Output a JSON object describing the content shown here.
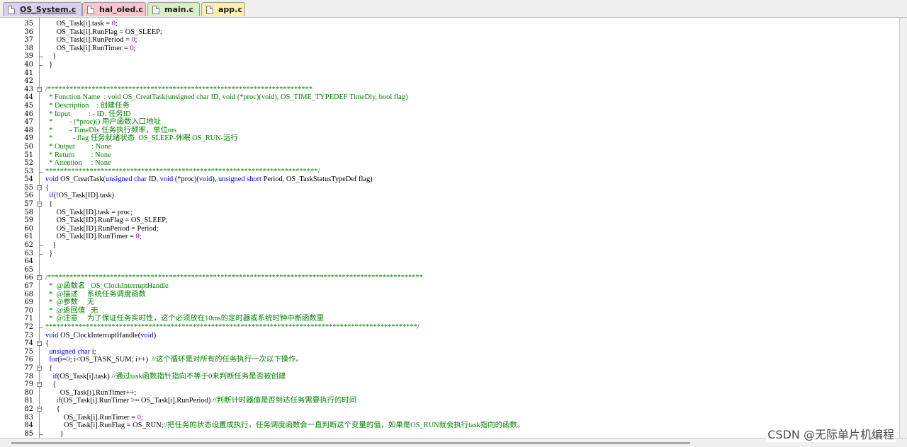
{
  "tabs": [
    {
      "label": "OS_System.c",
      "active": true,
      "color": "#d8d0ee"
    },
    {
      "label": "hal_oled.c",
      "active": false,
      "color": "#f7c6cc"
    },
    {
      "label": "main.c",
      "active": false,
      "color": "#d8efc6"
    },
    {
      "label": "app.c",
      "active": false,
      "color": "#fbefb0"
    }
  ],
  "lines": [
    {
      "n": "35",
      "fold": "",
      "segs": [
        [
          "t",
          "      OS_Task[i].task = "
        ],
        [
          "n",
          "0"
        ],
        [
          "t",
          ";"
        ]
      ]
    },
    {
      "n": "36",
      "fold": "",
      "segs": [
        [
          "t",
          "      OS_Task[i].RunFlag = OS_SLEEP;"
        ]
      ]
    },
    {
      "n": "37",
      "fold": "",
      "segs": [
        [
          "t",
          "      OS_Task[i].RunPeriod = "
        ],
        [
          "n",
          "0"
        ],
        [
          "t",
          ";"
        ]
      ]
    },
    {
      "n": "38",
      "fold": "",
      "segs": [
        [
          "t",
          "      OS_Task[i].RunTimer = "
        ],
        [
          "n",
          "0"
        ],
        [
          "t",
          ";"
        ]
      ]
    },
    {
      "n": "39",
      "fold": "end",
      "segs": [
        [
          "t",
          "    }"
        ]
      ]
    },
    {
      "n": "40",
      "fold": "end",
      "segs": [
        [
          "t",
          "  }"
        ]
      ]
    },
    {
      "n": "41",
      "fold": "",
      "segs": []
    },
    {
      "n": "42",
      "fold": "",
      "segs": []
    },
    {
      "n": "43",
      "fold": "open",
      "segs": [
        [
          "c",
          "/************************************************************************"
        ]
      ]
    },
    {
      "n": "44",
      "fold": "",
      "segs": [
        [
          "c",
          "  * Function Name  : void OS_CreatTask(unsigned char ID, void (*proc)(void), OS_TIME_TYPEDEF TimeDly, bool flag)"
        ]
      ]
    },
    {
      "n": "45",
      "fold": "",
      "segs": [
        [
          "c",
          "  * Description    : 创建任务"
        ]
      ]
    },
    {
      "n": "46",
      "fold": "",
      "segs": [
        [
          "c",
          "  * Input          : - ID: 任务ID"
        ]
      ]
    },
    {
      "n": "47",
      "fold": "",
      "segs": [
        [
          "c",
          "  *         - (*proc)() 用户函数入口地址"
        ]
      ]
    },
    {
      "n": "48",
      "fold": "",
      "segs": [
        [
          "c",
          "  *         - TimeDly 任务执行频率，单位ms"
        ]
      ]
    },
    {
      "n": "49",
      "fold": "",
      "segs": [
        [
          "c",
          "  *           - flag 任务就绪状态  OS_SLEEP-休眠 OS_RUN-运行"
        ]
      ]
    },
    {
      "n": "50",
      "fold": "",
      "segs": [
        [
          "c",
          "  * Output         : None"
        ]
      ]
    },
    {
      "n": "51",
      "fold": "",
      "segs": [
        [
          "c",
          "  * Return         : None"
        ]
      ]
    },
    {
      "n": "52",
      "fold": "",
      "segs": [
        [
          "c",
          "  * Attention     : None"
        ]
      ]
    },
    {
      "n": "53",
      "fold": "end",
      "segs": [
        [
          "c",
          "**************************************************************************/"
        ]
      ]
    },
    {
      "n": "54",
      "fold": "",
      "segs": [
        [
          "k",
          "void"
        ],
        [
          "t",
          " OS_CreatTask("
        ],
        [
          "k",
          "unsigned char"
        ],
        [
          "t",
          " ID, "
        ],
        [
          "k",
          "void"
        ],
        [
          "t",
          " (*proc)("
        ],
        [
          "k",
          "void"
        ],
        [
          "t",
          "), "
        ],
        [
          "k",
          "unsigned short"
        ],
        [
          "t",
          " Period, OS_TaskStatusTypeDef flag)"
        ]
      ]
    },
    {
      "n": "55",
      "fold": "open",
      "segs": [
        [
          "t",
          "{"
        ]
      ]
    },
    {
      "n": "56",
      "fold": "",
      "segs": [
        [
          "t",
          "  "
        ],
        [
          "k",
          "if"
        ],
        [
          "t",
          "(!OS_Task[ID].task)"
        ]
      ]
    },
    {
      "n": "57",
      "fold": "open",
      "segs": [
        [
          "t",
          "  {"
        ]
      ]
    },
    {
      "n": "58",
      "fold": "",
      "segs": [
        [
          "t",
          "      OS_Task[ID].task = proc;"
        ]
      ]
    },
    {
      "n": "59",
      "fold": "",
      "segs": [
        [
          "t",
          "      OS_Task[ID].RunFlag = OS_SLEEP;"
        ]
      ]
    },
    {
      "n": "60",
      "fold": "",
      "segs": [
        [
          "t",
          "      OS_Task[ID].RunPeriod = Period;"
        ]
      ]
    },
    {
      "n": "61",
      "fold": "",
      "segs": [
        [
          "t",
          "      OS_Task[ID].RunTimer = "
        ],
        [
          "n",
          "0"
        ],
        [
          "t",
          ";"
        ]
      ]
    },
    {
      "n": "62",
      "fold": "end",
      "segs": [
        [
          "t",
          "    }"
        ]
      ]
    },
    {
      "n": "63",
      "fold": "end",
      "segs": [
        [
          "t",
          "  }"
        ]
      ]
    },
    {
      "n": "64",
      "fold": "",
      "segs": []
    },
    {
      "n": "65",
      "fold": "",
      "segs": []
    },
    {
      "n": "66",
      "fold": "open",
      "segs": [
        [
          "c",
          "/******************************************************************************************************"
        ]
      ]
    },
    {
      "n": "67",
      "fold": "",
      "segs": [
        [
          "c",
          "  *  @函数名   OS_ClockInterruptHandle"
        ]
      ]
    },
    {
      "n": "68",
      "fold": "",
      "segs": [
        [
          "c",
          "  *  @描述     系统任务调度函数"
        ]
      ]
    },
    {
      "n": "69",
      "fold": "",
      "segs": [
        [
          "c",
          "  *  @参数     无"
        ]
      ]
    },
    {
      "n": "70",
      "fold": "",
      "segs": [
        [
          "c",
          "  *  @返回值   无"
        ]
      ]
    },
    {
      "n": "71",
      "fold": "",
      "segs": [
        [
          "c",
          "  *  @注意     为了保证任务实时性，这个必须放在10ms的定时器或系统时钟中断函数里"
        ]
      ]
    },
    {
      "n": "72",
      "fold": "end",
      "segs": [
        [
          "c",
          "*****************************************************************************************************/"
        ]
      ]
    },
    {
      "n": "73",
      "fold": "",
      "segs": [
        [
          "k",
          "void"
        ],
        [
          "t",
          " OS_ClockInterruptHandle("
        ],
        [
          "k",
          "void"
        ],
        [
          "t",
          ")"
        ]
      ]
    },
    {
      "n": "74",
      "fold": "open",
      "segs": [
        [
          "t",
          "{"
        ]
      ]
    },
    {
      "n": "75",
      "fold": "",
      "segs": [
        [
          "t",
          "  "
        ],
        [
          "k",
          "unsigned char"
        ],
        [
          "t",
          " i;"
        ]
      ]
    },
    {
      "n": "76",
      "fold": "",
      "segs": [
        [
          "t",
          "  "
        ],
        [
          "k",
          "for"
        ],
        [
          "t",
          "(i="
        ],
        [
          "n",
          "0"
        ],
        [
          "t",
          "; i<OS_TASK_SUM; i++)  "
        ],
        [
          "c",
          "//这个循环是对所有的任务执行一次以下操作。"
        ]
      ]
    },
    {
      "n": "77",
      "fold": "open",
      "segs": [
        [
          "t",
          "  {"
        ]
      ]
    },
    {
      "n": "78",
      "fold": "",
      "segs": [
        [
          "t",
          "    "
        ],
        [
          "k",
          "if"
        ],
        [
          "t",
          "(OS_Task[i].task) "
        ],
        [
          "c",
          "//通过task函数指针指向不等于0来判断任务是否被创建"
        ]
      ]
    },
    {
      "n": "79",
      "fold": "open",
      "segs": [
        [
          "t",
          "    {"
        ]
      ]
    },
    {
      "n": "80",
      "fold": "",
      "segs": [
        [
          "t",
          "        OS_Task[i].RunTimer++;"
        ]
      ]
    },
    {
      "n": "81",
      "fold": "",
      "segs": [
        [
          "t",
          "      "
        ],
        [
          "k",
          "if"
        ],
        [
          "t",
          "(OS_Task[i].RunTimer >= OS_Task[i].RunPeriod) "
        ],
        [
          "c",
          "//判断计时器值是否到达任务需要执行的时间"
        ]
      ]
    },
    {
      "n": "82",
      "fold": "open",
      "segs": [
        [
          "t",
          "      {"
        ]
      ]
    },
    {
      "n": "83",
      "fold": "",
      "segs": [
        [
          "t",
          "          OS_Task[i].RunTimer = "
        ],
        [
          "n",
          "0"
        ],
        [
          "t",
          ";"
        ]
      ]
    },
    {
      "n": "84",
      "fold": "",
      "segs": [
        [
          "t",
          "          OS_Task[i].RunFlag = OS_RUN;"
        ],
        [
          "c",
          "//把任务的状态设置成执行，任务调度函数会一直判断这个变量的值，如果是OS_RUN就会执行task指向的函数。"
        ]
      ]
    },
    {
      "n": "85",
      "fold": "end",
      "segs": [
        [
          "t",
          "        }"
        ]
      ]
    }
  ],
  "watermark": "CSDN @无际单片机编程"
}
